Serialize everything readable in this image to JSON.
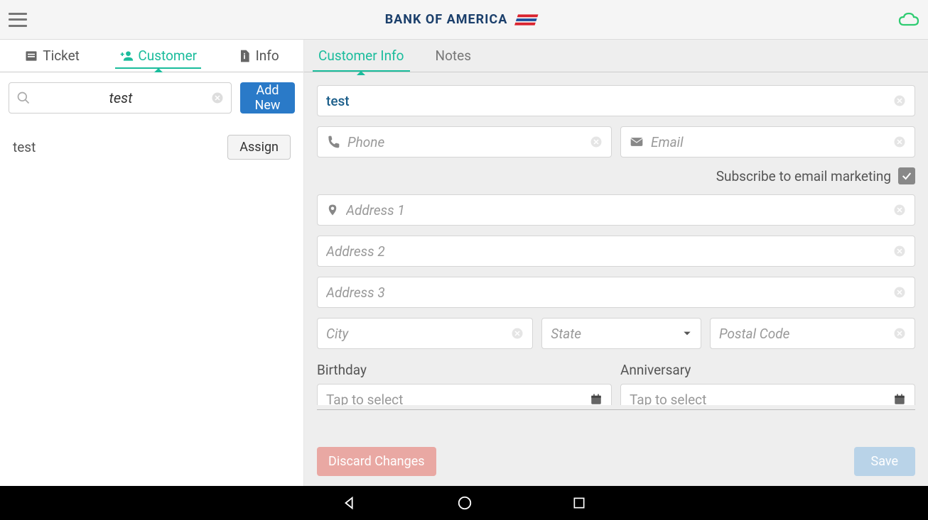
{
  "header": {
    "brand_text": "BANK OF AMERICA"
  },
  "sidebar": {
    "tabs": {
      "ticket": "Ticket",
      "customer": "Customer",
      "info": "Info"
    },
    "search_value": "test",
    "add_new_label": "Add New",
    "results": [
      {
        "name": "test",
        "assign_label": "Assign"
      }
    ]
  },
  "content_tabs": {
    "customer_info": "Customer Info",
    "notes": "Notes"
  },
  "form": {
    "name_value": "test",
    "phone_placeholder": "Phone",
    "email_placeholder": "Email",
    "subscribe_label": "Subscribe to email marketing",
    "subscribe_checked": true,
    "address1_placeholder": "Address 1",
    "address2_placeholder": "Address 2",
    "address3_placeholder": "Address 3",
    "city_placeholder": "City",
    "state_placeholder": "State",
    "postal_placeholder": "Postal Code",
    "birthday_label": "Birthday",
    "anniversary_label": "Anniversary",
    "date_placeholder": "Tap to select"
  },
  "actions": {
    "discard_label": "Discard Changes",
    "save_label": "Save"
  }
}
